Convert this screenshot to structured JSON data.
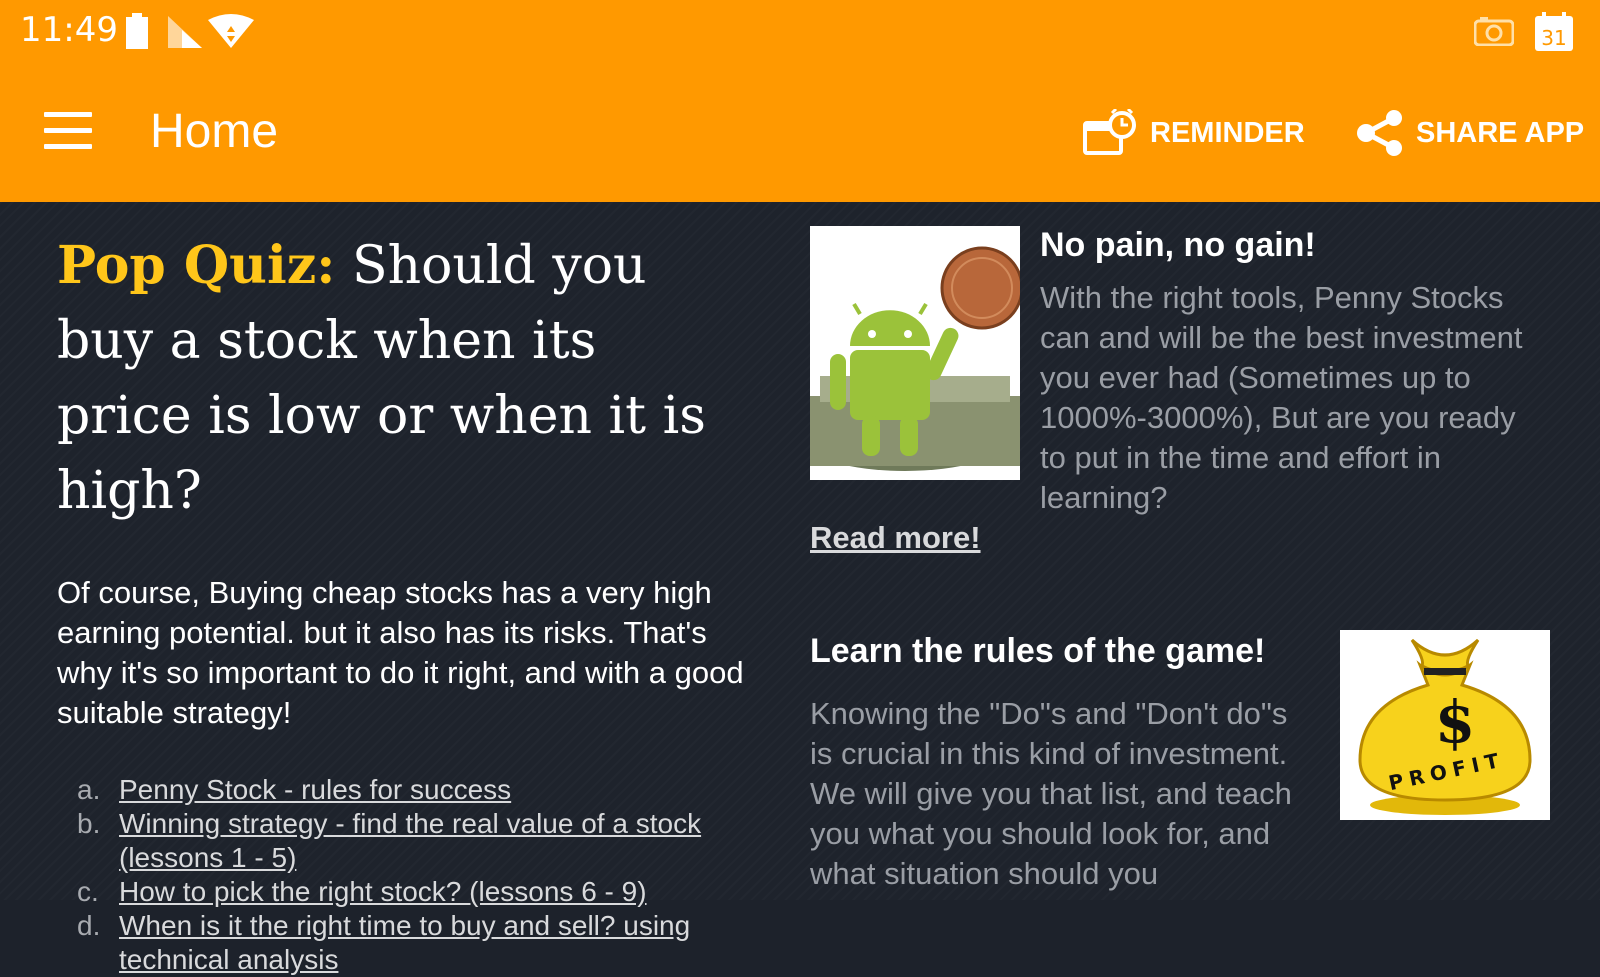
{
  "status_bar": {
    "time": "11:49",
    "icons": [
      "battery-icon",
      "cell-signal-icon",
      "wifi-icon",
      "camera-icon",
      "calendar-icon"
    ],
    "calendar_day": "31"
  },
  "toolbar": {
    "title": "Home",
    "reminder_label": "REMINDER",
    "share_label": "SHARE APP",
    "background": "#ff9900"
  },
  "quiz": {
    "highlight": "Pop Quiz:",
    "question": " Should you buy a stock when its price is low or when it is high?",
    "highlight_color": "#ffc61a"
  },
  "intro": "Of course, Buying cheap stocks has a very high earning potential. but it also has its risks. That's why it's so important to do it right, and with a good suitable strategy!",
  "lessons": [
    {
      "marker": "a.",
      "label": "Penny Stock - rules for success"
    },
    {
      "marker": "b.",
      "label": "Winning strategy - find the real value of a stock (lessons 1 - 5)"
    },
    {
      "marker": "c.",
      "label": "How to pick the right stock? (lessons 6 - 9)"
    },
    {
      "marker": "d.",
      "label": "When is it the right time to buy and sell? using technical analysis"
    }
  ],
  "card1": {
    "title": "No pain, no gain!",
    "text": "With the right tools, Penny Stocks can and will be the best investment you ever had (Sometimes up to 1000%-3000%), But are you ready to put in the time and effort in learning?",
    "link": "Read more!",
    "image": "android-on-money-image"
  },
  "card2": {
    "title": "Learn the rules of the game!",
    "text": "Knowing the \"Do\"s and \"Don't do\"s is crucial in this kind of investment. We will give you that list, and teach you what you should look for, and what situation should you",
    "image": "profit-money-bag-image",
    "image_symbol": "$",
    "image_text": "PROFIT"
  },
  "colors": {
    "background": "#1e232c",
    "accent": "#ff9900",
    "muted_text": "#9a9ea5"
  }
}
